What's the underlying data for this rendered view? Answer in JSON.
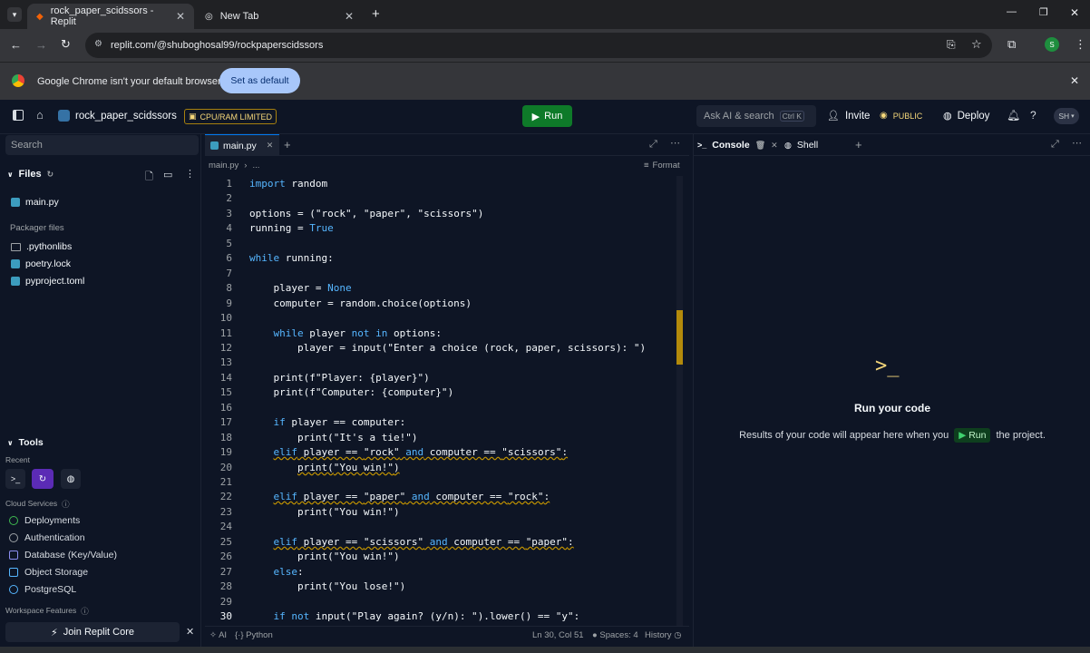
{
  "browser": {
    "tabs": [
      {
        "title": "rock_paper_scidssors - Replit"
      },
      {
        "title": "New Tab"
      }
    ],
    "url": "replit.com/@shuboghosal99/rockpaperscidssors",
    "infobar_text": "Google Chrome isn't your default browser",
    "set_default_label": "Set as default",
    "profile_initial": "S"
  },
  "replit": {
    "repl_name": "rock_paper_scidssors",
    "badge": "CPU/RAM LIMITED",
    "run_label": "Run",
    "ask_ai": "Ask AI & search",
    "shortcut": "Ctrl K",
    "invite": "Invite",
    "public": "PUBLIC",
    "deploy": "Deploy",
    "avatar": "SH"
  },
  "sidebar": {
    "search_placeholder": "Search",
    "files_label": "Files",
    "files": [
      "main.py"
    ],
    "packager_label": "Packager files",
    "packager_files": [
      ".pythonlibs",
      "poetry.lock",
      "pyproject.toml"
    ],
    "tools_label": "Tools",
    "recent_label": "Recent",
    "cloud_label": "Cloud Services",
    "services": [
      "Deployments",
      "Authentication",
      "Database (Key/Value)",
      "Object Storage",
      "PostgreSQL"
    ],
    "workspace_label": "Workspace Features",
    "join_core": "Join Replit Core"
  },
  "editor": {
    "tab": "main.py",
    "breadcrumb": "main.py",
    "breadcrumb_more": "...",
    "format": "Format",
    "lines": [
      "import random",
      "",
      "options = (\"rock\", \"paper\", \"scissors\")",
      "running = True",
      "",
      "while running:",
      "",
      "    player = None",
      "    computer = random.choice(options)",
      "",
      "    while player not in options:",
      "        player = input(\"Enter a choice (rock, paper, scissors): \")",
      "",
      "    print(f\"Player: {player}\")",
      "    print(f\"Computer: {computer}\")",
      "",
      "    if player == computer:",
      "        print(\"It's a tie!\")",
      "    elif player == \"rock\" and computer == \"scissors\":",
      "        print(\"You win!\")",
      "",
      "    elif player == \"paper\" and computer == \"rock\":",
      "        print(\"You win!\")",
      "",
      "    elif player == \"scissors\" and computer == \"paper\":",
      "        print(\"You win!\")",
      "    else:",
      "        print(\"You lose!\")",
      "",
      "    if not input(\"Play again? (y/n): \").lower() == \"y\":"
    ],
    "current_line": 30,
    "status_ai": "AI",
    "status_lang": "Python",
    "status_pos": "Ln 30, Col 51",
    "status_spaces": "Spaces: 4",
    "status_history": "History"
  },
  "console": {
    "tab_console": "Console",
    "tab_shell": "Shell",
    "prompt_glyph": ">_",
    "heading": "Run your code",
    "msg_before": "Results of your code will appear here when you",
    "run_chip": "Run",
    "msg_after": "the project."
  }
}
